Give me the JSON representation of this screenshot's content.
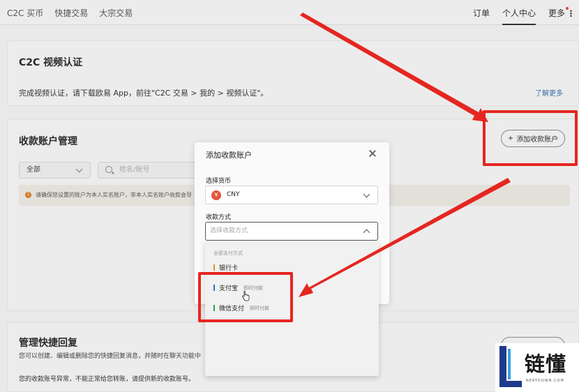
{
  "nav": {
    "items": [
      "C2C 买币",
      "快捷交易",
      "大宗交易"
    ],
    "right": [
      "订单",
      "个人中心",
      "更多"
    ]
  },
  "video_card": {
    "title": "C2C 视频认证",
    "desc": "完成视频认证，请下载欧易 App，前往\"C2C 交易 > 我的 > 视频认证\"。",
    "link": "了解更多"
  },
  "account_card": {
    "title": "收款账户管理",
    "add_button": "添加收款账户",
    "filter": "全部",
    "search_placeholder": "姓名/账号",
    "notice": "请确保您设置的账户为本人实名账户，非本人实名账户收款会导"
  },
  "reply_card": {
    "title": "管理快捷回复",
    "desc": "您可以创建、编辑或删除您的快捷回复消息，并随时在聊天功能中",
    "foot": "您的收款账号异常，不能正常给您转账，请提供新的收款账号。"
  },
  "modal": {
    "title": "添加收款账户",
    "currency_label": "选择货币",
    "currency_symbol": "¥",
    "currency_value": "CNY",
    "method_label": "收款方式",
    "method_placeholder": "选择收款方式"
  },
  "dropdown": {
    "group_label": "全部支付方式",
    "options": [
      {
        "label": "银行卡",
        "tag": "",
        "color": "#d9902a"
      },
      {
        "label": "支付宝",
        "tag": "即时付款",
        "color": "#2a6fd6"
      },
      {
        "label": "微信支付",
        "tag": "即时付款",
        "color": "#2aa04a"
      }
    ]
  },
  "watermark": {
    "brand": "链懂",
    "domain": "NEATDOWN.COM"
  },
  "colors": {
    "annotation_red": "#e52620"
  }
}
